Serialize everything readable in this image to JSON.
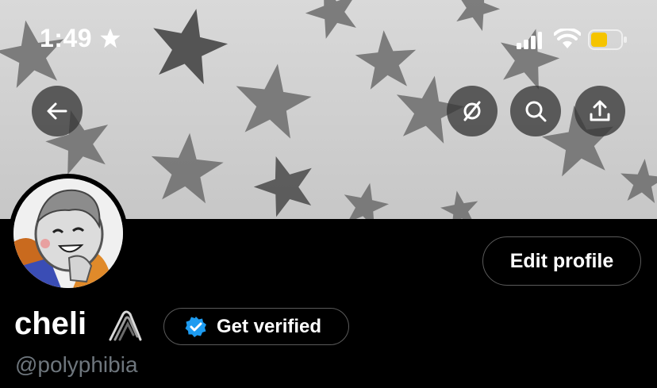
{
  "status_bar": {
    "time": "1:49",
    "time_icon": "star-icon",
    "icons": [
      "signal-icon",
      "wifi-icon",
      "battery-icon"
    ],
    "battery_color": "#f5c400"
  },
  "banner": {
    "description_icon": "stars-pattern",
    "buttons": [
      "back-icon",
      "no-sync-icon",
      "search-icon",
      "share-icon"
    ]
  },
  "profile": {
    "edit_label": "Edit profile",
    "name": "cheli",
    "name_icon": "paperclip-icon",
    "verify_label": "Get verified",
    "verify_color": "#1d9bf0",
    "handle": "@polyphibia"
  }
}
